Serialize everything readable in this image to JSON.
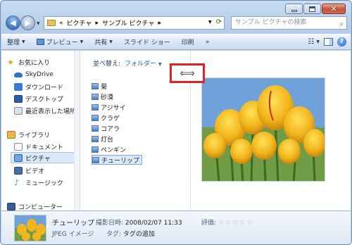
{
  "address": {
    "back_glyph": "◀",
    "forward_glyph": "▶",
    "breadcrumb_sep": "«",
    "path": [
      "ライブラリ",
      "ピクチャ",
      "サンプル ピクチャ"
    ],
    "visible_path": [
      "ピクチャ",
      "サンプル ピクチャ"
    ],
    "path_arrow": "▸",
    "search_placeholder": "サンプル ピクチャの検索"
  },
  "toolbar": {
    "organize": "整理",
    "preview": "プレビュー",
    "share": "共有",
    "slideshow": "スライド ショー",
    "print": "印刷",
    "more": "»"
  },
  "nav": {
    "favorites": "お気に入り",
    "skydrive": "SkyDrive",
    "downloads": "ダウンロード",
    "desktop": "デスクトップ",
    "recent": "最近表示した場所",
    "libraries": "ライブラリ",
    "documents": "ドキュメント",
    "pictures": "ピクチャ",
    "videos": "ビデオ",
    "music": "ミュージック",
    "computer": "コンピューター"
  },
  "content": {
    "sort_label": "並べ替え:",
    "sort_value": "フォルダー",
    "files": [
      "菊",
      "砂漠",
      "アジサイ",
      "クラゲ",
      "コアラ",
      "灯台",
      "ペンギン",
      "チューリップ"
    ],
    "selected_index": 7
  },
  "callout": {
    "glyph": "⟺"
  },
  "details": {
    "name": "チューリップ",
    "type": "JPEG イメージ",
    "date_label": "撮影日時:",
    "date_value": "2008/02/07 11:33",
    "tag_label": "タグ:",
    "tag_value": "タグの追加",
    "rating_label": "評価:",
    "rating": 0,
    "rating_max": 5
  },
  "colors": {
    "accent": "#2660c4",
    "callout_border": "#e2202a",
    "selection": "#dbe9f8"
  }
}
